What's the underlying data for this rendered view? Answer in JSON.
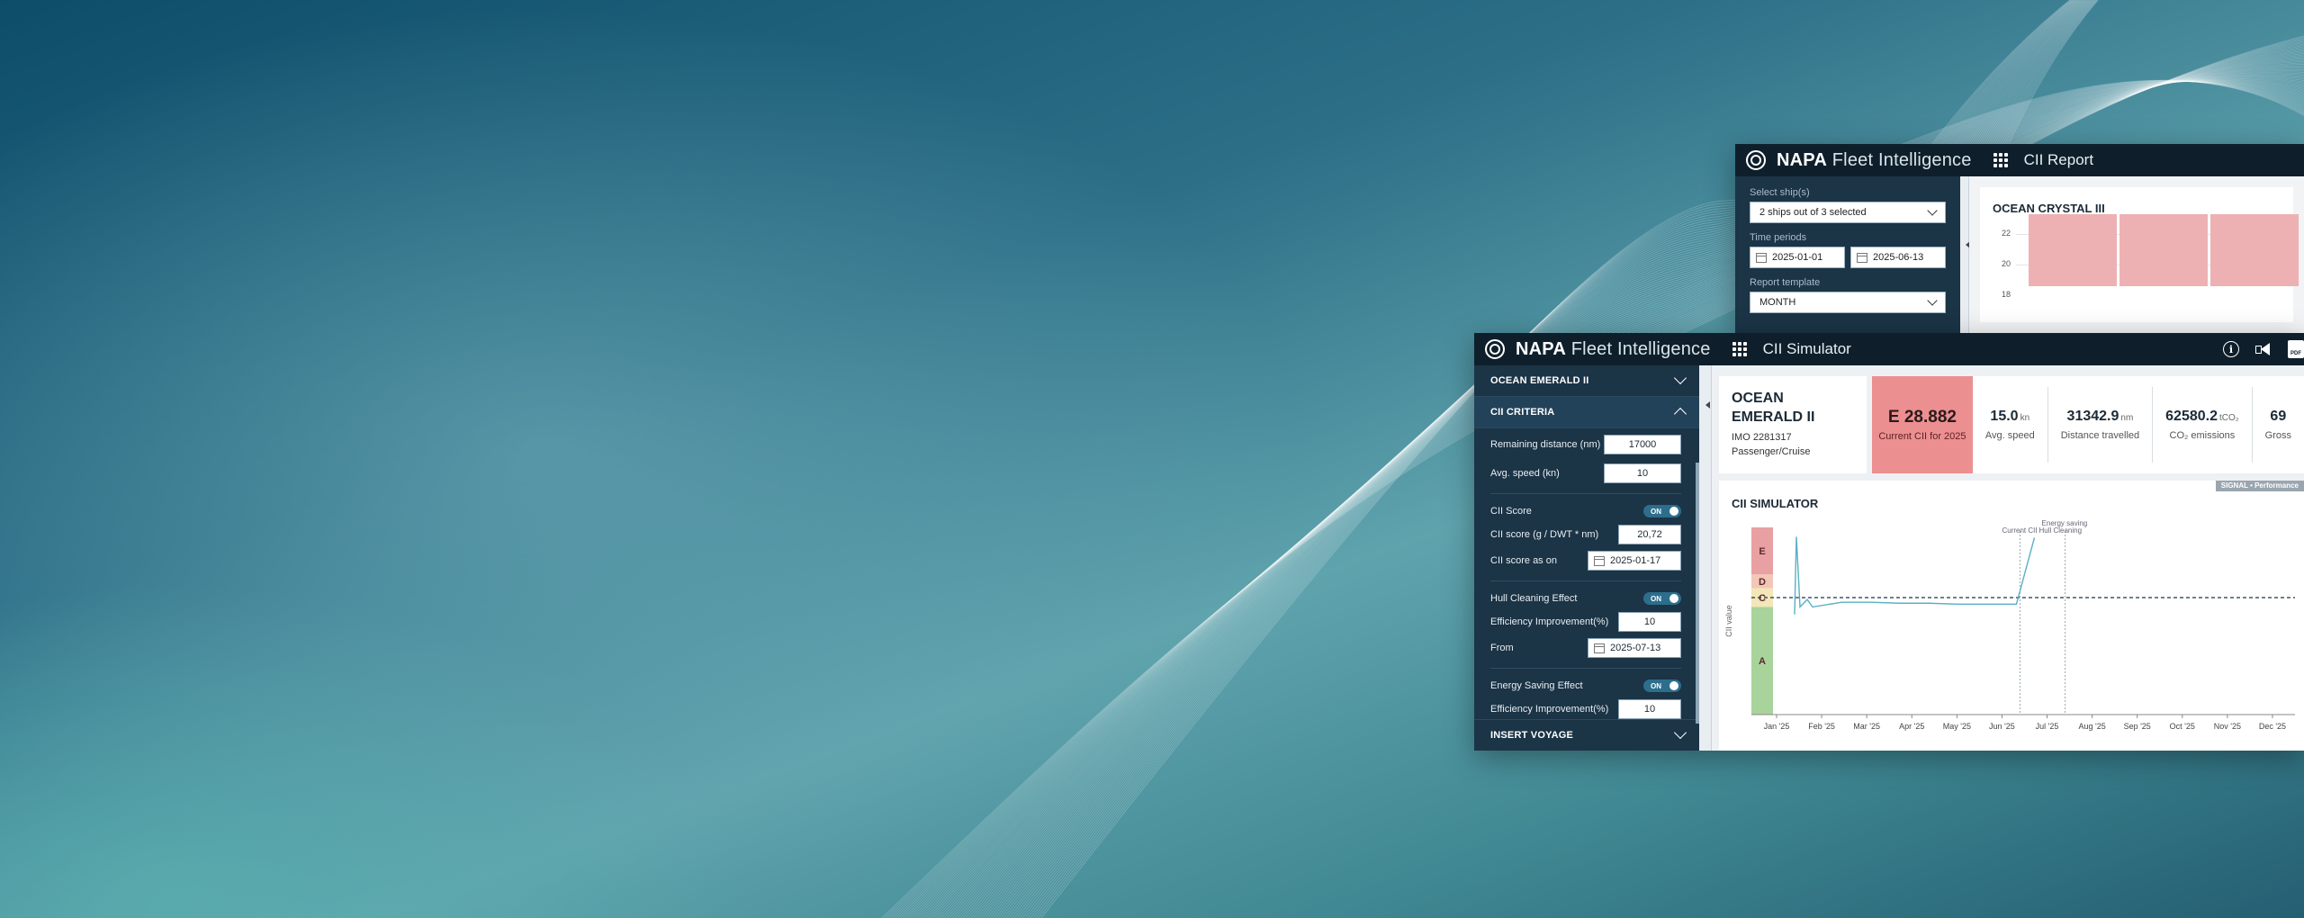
{
  "report_window": {
    "brand_bold": "NAPA",
    "brand_rest": "Fleet Intelligence",
    "app_title": "CII Report",
    "select_ships_label": "Select ship(s)",
    "select_ships_value": "2 ships out of 3 selected",
    "time_periods_label": "Time periods",
    "date_from": "2025-01-01",
    "date_to": "2025-06-13",
    "report_template_label": "Report template",
    "report_template_value": "MONTH",
    "ship_name": "OCEAN CRYSTAL III",
    "y_ticks": [
      "22",
      "20",
      "18"
    ]
  },
  "sim_window": {
    "brand_bold": "NAPA",
    "brand_rest": "Fleet Intelligence",
    "app_title": "CII Simulator",
    "icons": [
      "info-icon",
      "megaphone-icon",
      "pdf-icon"
    ],
    "sidebar": {
      "ship_section": "OCEAN EMERALD II",
      "criteria_section": "CII CRITERIA",
      "remaining_distance_label": "Remaining distance (nm)",
      "remaining_distance_value": "17000",
      "avg_speed_label": "Avg. speed (kn)",
      "avg_speed_value": "10",
      "cii_score_label": "CII Score",
      "cii_score_toggle": "ON",
      "cii_score_input_label": "CII score (g / DWT * nm)",
      "cii_score_input_value": "20,72",
      "cii_score_as_on_label": "CII score as on",
      "cii_score_as_on_value": "2025-01-17",
      "hull_label": "Hull Cleaning Effect",
      "hull_toggle": "ON",
      "hull_eff_label": "Efficiency Improvement(%)",
      "hull_eff_value": "10",
      "from_label": "From",
      "from_value": "2025-07-13",
      "energy_label": "Energy Saving Effect",
      "energy_toggle": "ON",
      "energy_eff_label": "Efficiency Improvement(%)",
      "energy_eff_value": "10",
      "insert_voyage_section": "INSERT VOYAGE"
    },
    "ship_card": {
      "name": "OCEAN EMERALD II",
      "imo": "IMO 2281317",
      "type": "Passenger/Cruise"
    },
    "kpis": {
      "current_cii_value": "E 28.882",
      "current_cii_label": "Current CII for 2025",
      "avg_speed_value": "15.0",
      "avg_speed_unit": "kn",
      "avg_speed_label": "Avg. speed",
      "distance_value": "31342.9",
      "distance_unit": "nm",
      "distance_label": "Distance travelled",
      "co2_value": "62580.2",
      "co2_unit": "tCO₂",
      "co2_label": "CO₂ emissions",
      "gross_value": "69",
      "gross_label": "Gross"
    },
    "chart_title": "CII SIMULATOR",
    "signal_badge": "SIGNAL • Performance"
  },
  "colors": {
    "accent": "#ec8f91",
    "sidebar": "#1b3446",
    "titlebar": "#0e1f2b",
    "line": "#5ab0c4"
  },
  "chart_data": {
    "type": "line",
    "title": "CII SIMULATOR",
    "ylabel": "CII value",
    "categories": [
      "Jan '25",
      "Feb '25",
      "Mar '25",
      "Apr '25",
      "May '25",
      "Jun '25",
      "Jul '25",
      "Aug '25",
      "Sep '25",
      "Oct '25",
      "Nov '25",
      "Dec '25"
    ],
    "rating_bands": [
      {
        "name": "E",
        "color": "#e9a0a2"
      },
      {
        "name": "D",
        "color": "#f2c7b7"
      },
      {
        "name": "C",
        "color": "#f3e6b8"
      },
      {
        "name": "A",
        "color": "#a8d39b"
      }
    ],
    "annotations": [
      "Energy saving",
      "Current CII",
      "Hull Cleaning"
    ],
    "reference_line": "C",
    "series": [
      {
        "values": [
          20.7,
          29.0,
          21.5,
          22.3,
          22.0,
          22.0,
          21.9,
          21.9,
          21.8,
          21.8,
          21.8,
          28.9
        ]
      }
    ]
  }
}
